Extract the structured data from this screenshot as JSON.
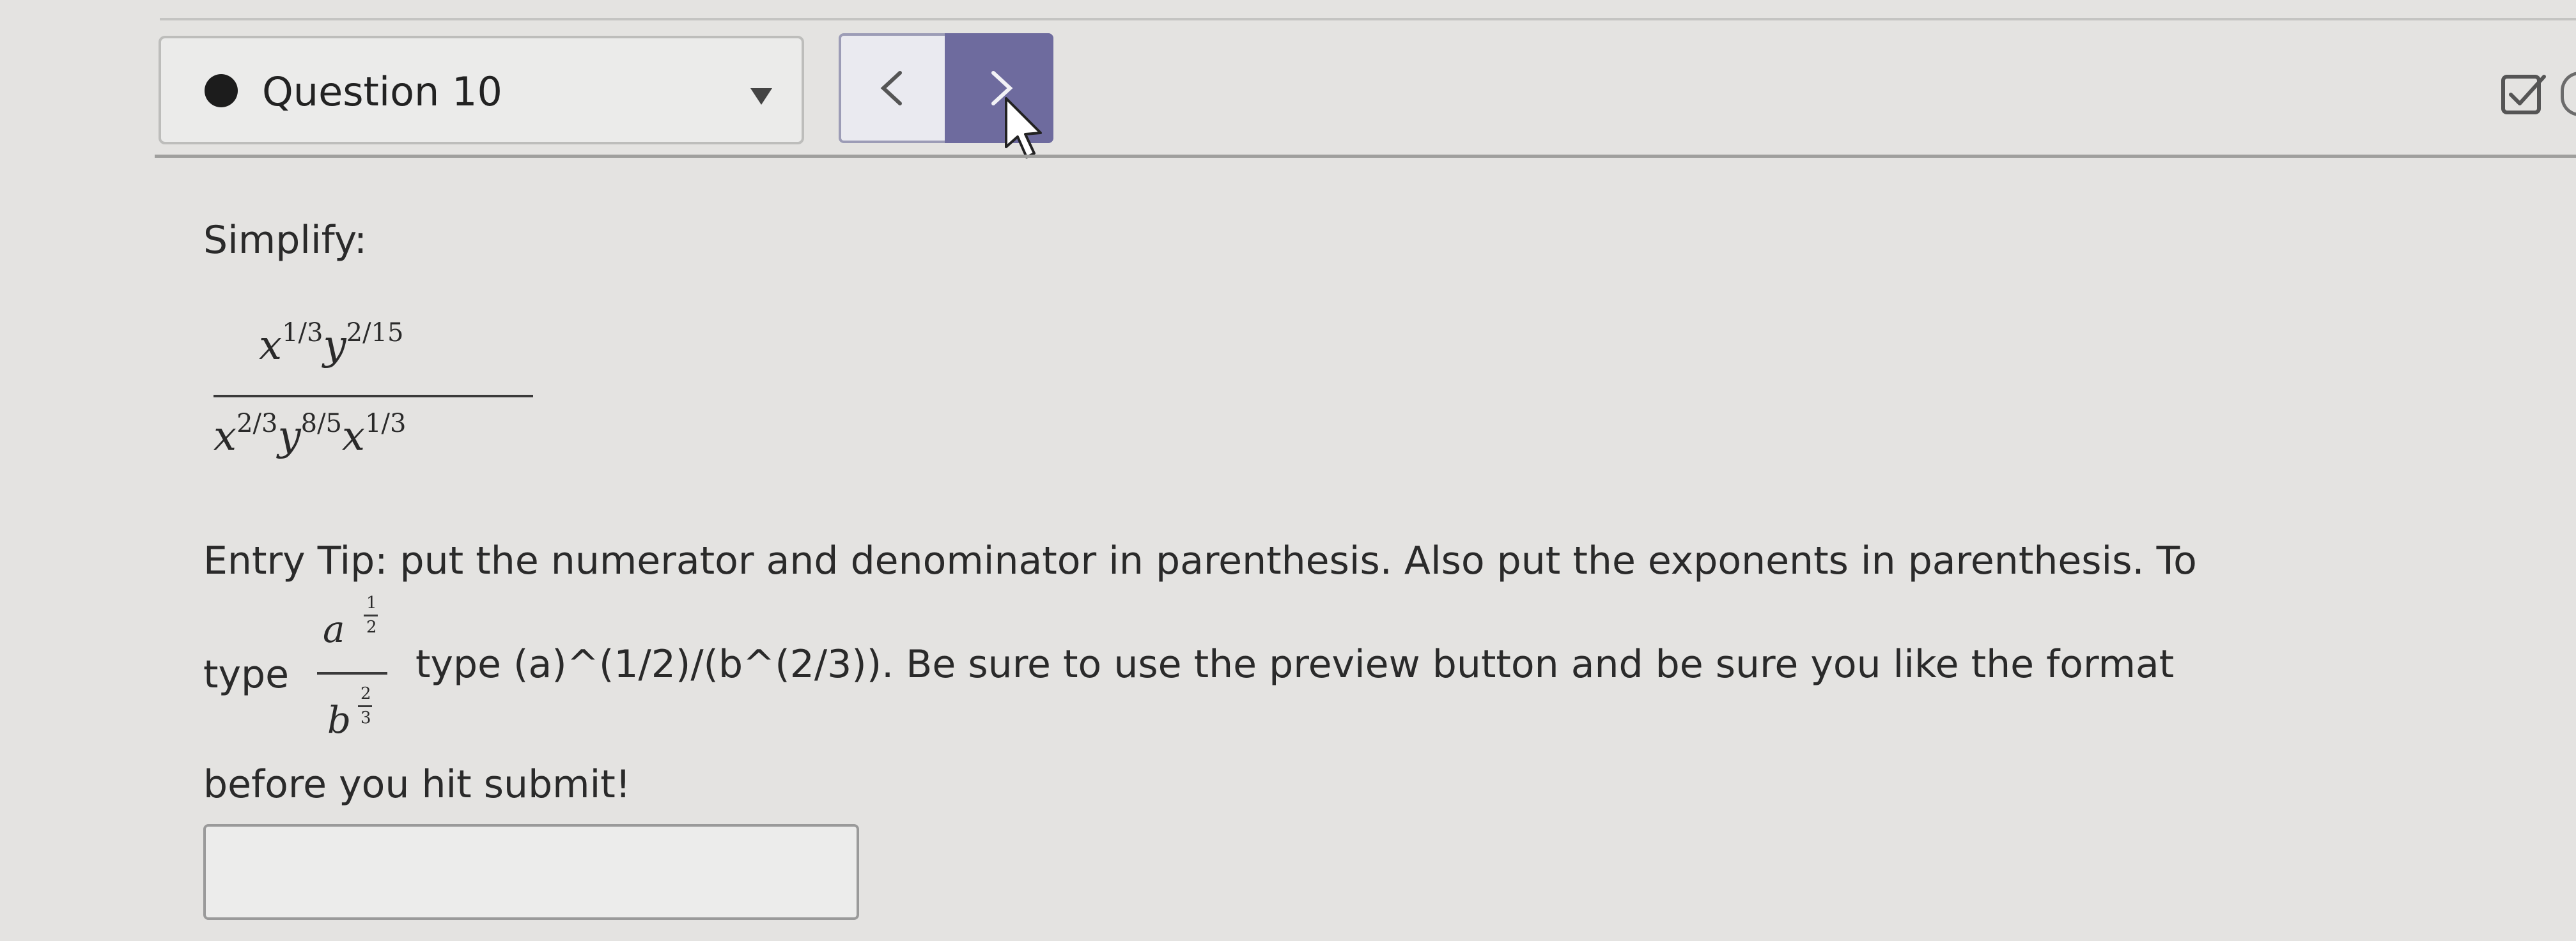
{
  "header": {
    "question_label": "Question 10",
    "prev_icon": "chevron-left-icon",
    "next_icon": "chevron-right-icon",
    "check_icon": "checkbox-check-icon"
  },
  "problem": {
    "instruction": "Simplify:",
    "expression": {
      "numerator": {
        "parts": [
          {
            "base": "x",
            "exp": "1/3"
          },
          {
            "base": "y",
            "exp": "2/15"
          }
        ]
      },
      "denominator": {
        "parts": [
          {
            "base": "x",
            "exp": "2/3"
          },
          {
            "base": "y",
            "exp": "8/5"
          },
          {
            "base": "x",
            "exp": "1/3"
          }
        ]
      }
    },
    "tip_line1": "Entry Tip: put the numerator and denominator in parenthesis. Also put the exponents in parenthesis. To",
    "tip_type_word": "type",
    "tip_example": {
      "num_base": "a",
      "num_exp_num": "1",
      "num_exp_den": "2",
      "den_base": "b",
      "den_exp_num": "2",
      "den_exp_den": "3"
    },
    "tip_line2_rest": "type (a)^(1/2)/(b^(2/3)). Be sure to use the preview button and be sure you like the format",
    "tip_line3": "before you hit submit!"
  },
  "answer": {
    "value": ""
  }
}
